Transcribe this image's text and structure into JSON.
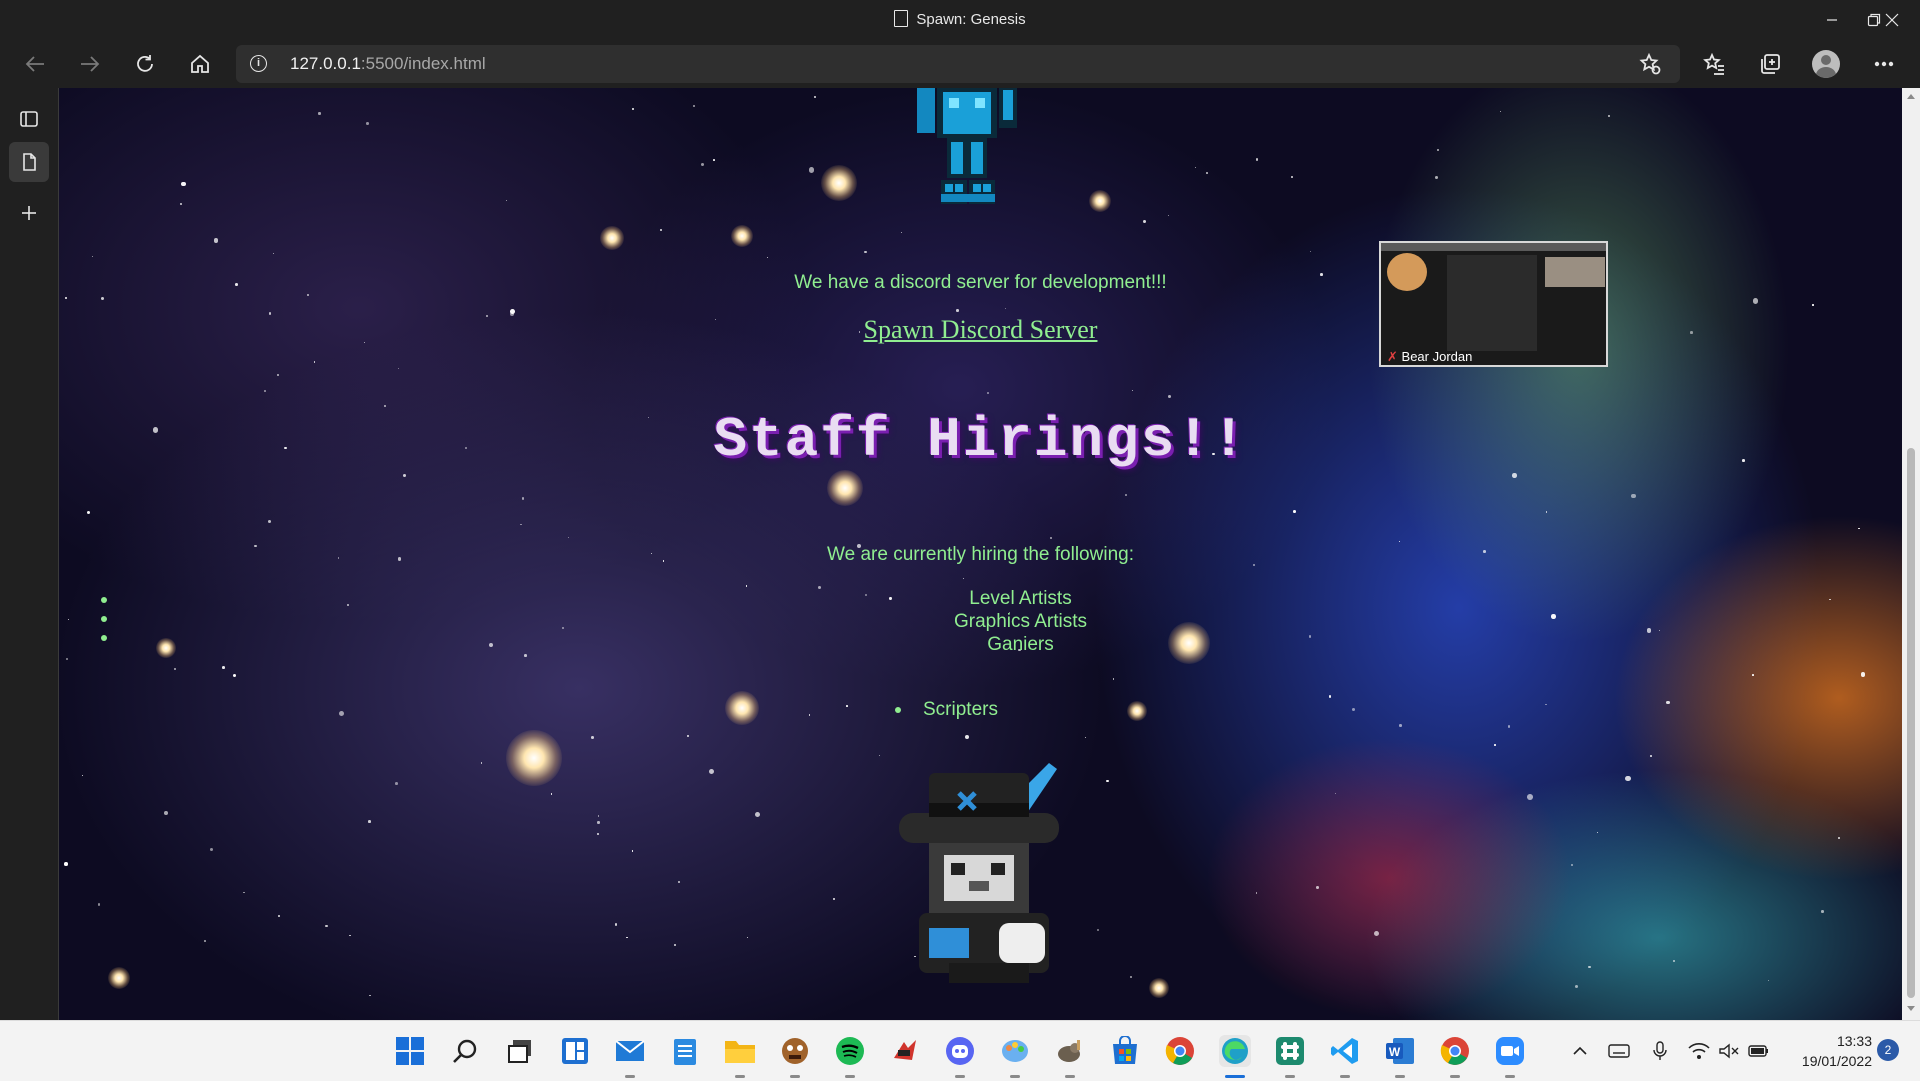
{
  "window": {
    "title": "Spawn: Genesis"
  },
  "browser": {
    "url_host": "127.0.0.1",
    "url_rest": ":5500/index.html"
  },
  "page": {
    "discord_text": "We have a discord server for development!!!",
    "discord_link": "Spawn Discord Server",
    "heading": "Staff Hirings!!",
    "hiring_text": "We are currently hiring the following:",
    "roles": [
      "Level Artists",
      "Graphics Artists",
      "Ganiers"
    ],
    "bullet_role": "Scripters"
  },
  "video_overlay": {
    "participant_name": "Bear Jordan"
  },
  "taskbar": {
    "apps": [
      "start",
      "search",
      "task-view",
      "widgets",
      "mail",
      "notepad",
      "file-explorer",
      "game-app",
      "spotify",
      "cheat-engine",
      "discord",
      "paint",
      "gimp",
      "store",
      "chrome",
      "edge",
      "slack",
      "vscode",
      "word",
      "chrome",
      "zoom"
    ],
    "time": "13:33",
    "date": "19/01/2022",
    "notification_count": "2"
  },
  "colors": {
    "text_green": "#90ee90",
    "heading_shadow": "#7a1fb0",
    "browser_bg": "#202020"
  }
}
